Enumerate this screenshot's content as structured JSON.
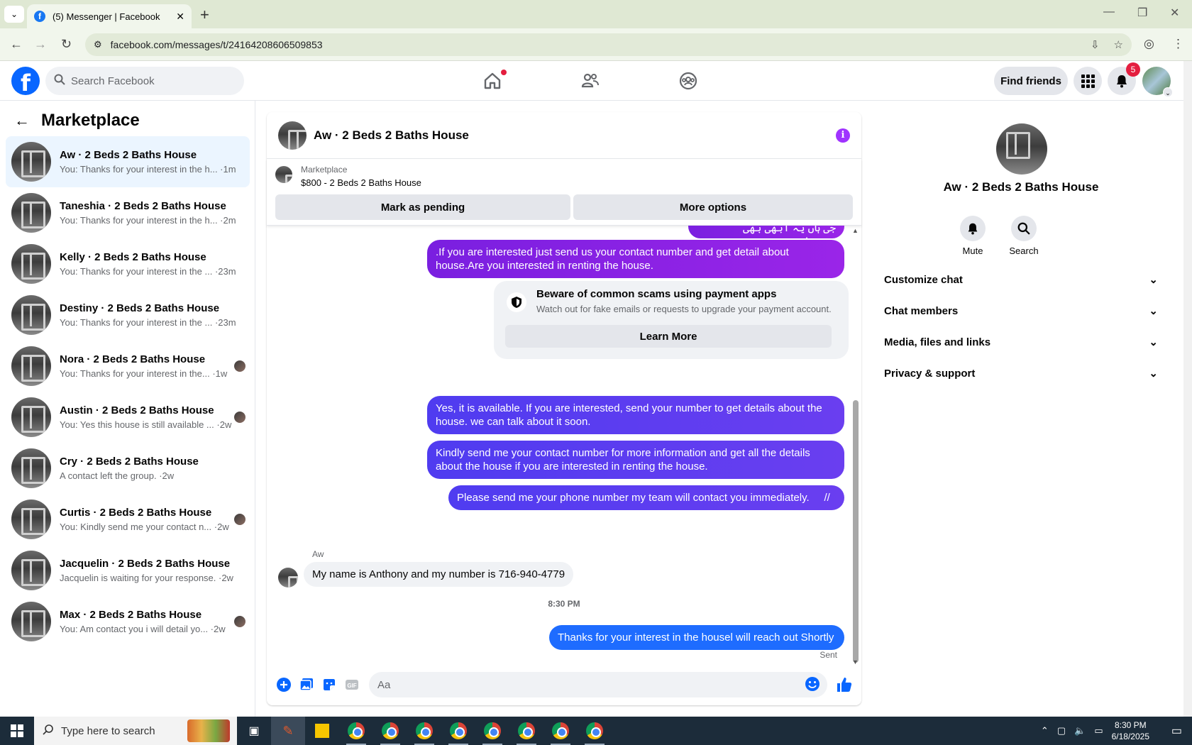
{
  "browser": {
    "tab_title": "(5) Messenger | Facebook",
    "url": "facebook.com/messages/t/24164208606509853"
  },
  "topbar": {
    "search_placeholder": "Search Facebook",
    "find_friends_label": "Find friends",
    "notification_count": "5"
  },
  "sidebar": {
    "title": "Marketplace",
    "conversations": [
      {
        "name": "Aw · 2 Beds 2 Baths House",
        "preview": "You: Thanks for your interest in the h... ·1m",
        "active": true
      },
      {
        "name": "Taneshia · 2 Beds 2 Baths House",
        "preview": "You: Thanks for your interest in the h... ·2m"
      },
      {
        "name": "Kelly · 2 Beds 2 Baths House",
        "preview": "You: Thanks for your interest in the ... ·23m"
      },
      {
        "name": "Destiny · 2 Beds 2 Baths House",
        "preview": "You: Thanks for your interest in the ... ·23m"
      },
      {
        "name": "Nora · 2 Beds 2 Baths House",
        "preview": "You: Thanks for your interest in the... ·1w"
      },
      {
        "name": "Austin · 2 Beds 2 Baths House",
        "preview": "You: Yes this house is still available ... ·2w"
      },
      {
        "name": "Cry · 2 Beds 2 Baths House",
        "preview": "A contact left the group. ·2w"
      },
      {
        "name": "Curtis · 2 Beds 2 Baths House",
        "preview": "You: Kindly send me your contact n... ·2w"
      },
      {
        "name": "Jacquelin · 2 Beds 2 Baths House",
        "preview": "Jacquelin is waiting for your response. ·2w"
      },
      {
        "name": "Max · 2 Beds 2 Baths House",
        "preview": "You: Am contact you i will detail yo... ·2w"
      }
    ]
  },
  "chat": {
    "title": "Aw · 2 Beds 2 Baths House",
    "marketplace_label": "Marketplace",
    "listing": "$800 - 2 Beds 2 Baths House",
    "mark_pending_label": "Mark as pending",
    "more_options_label": "More options",
    "messages": {
      "m0": "جی ہاں یہ ابھی بھی دستیاب ہے",
      "m1": ".If you are interested just send us your contact number and get detail about house.Are you interested in renting the house.",
      "m2": "Yes, it is available. If you are interested, send your number to get details about the house. we can talk about it soon.",
      "m3": "Kindly send me your contact number for more information and get all the details about the house if you are interested in renting the house.",
      "m4": "Please send me your phone number my team will contact you immediately.     //",
      "incoming": "My name is Anthony and my number is 716-940-4779",
      "last": "Thanks for your interest in the housel will reach out Shortly"
    },
    "scam_title": "Beware of common scams using payment apps",
    "scam_text": "Watch out for fake emails or requests to upgrade your payment account.",
    "learn_more_label": "Learn More",
    "sender_name": "Aw",
    "timestamp": "8:30 PM",
    "sent_label": "Sent",
    "composer_placeholder": "Aa"
  },
  "details": {
    "name": "Aw · 2 Beds 2 Baths House",
    "mute_label": "Mute",
    "search_label": "Search",
    "menu": [
      "Customize chat",
      "Chat members",
      "Media, files and links",
      "Privacy & support"
    ]
  },
  "taskbar": {
    "search_placeholder": "Type here to search",
    "time": "8:30 PM",
    "date": "6/18/2025"
  },
  "colors": {
    "fb_blue": "#0866ff",
    "purple_bubble": "#8a22e6",
    "blue_bubble": "#1e6cff",
    "badge_red": "#e41e3f"
  }
}
